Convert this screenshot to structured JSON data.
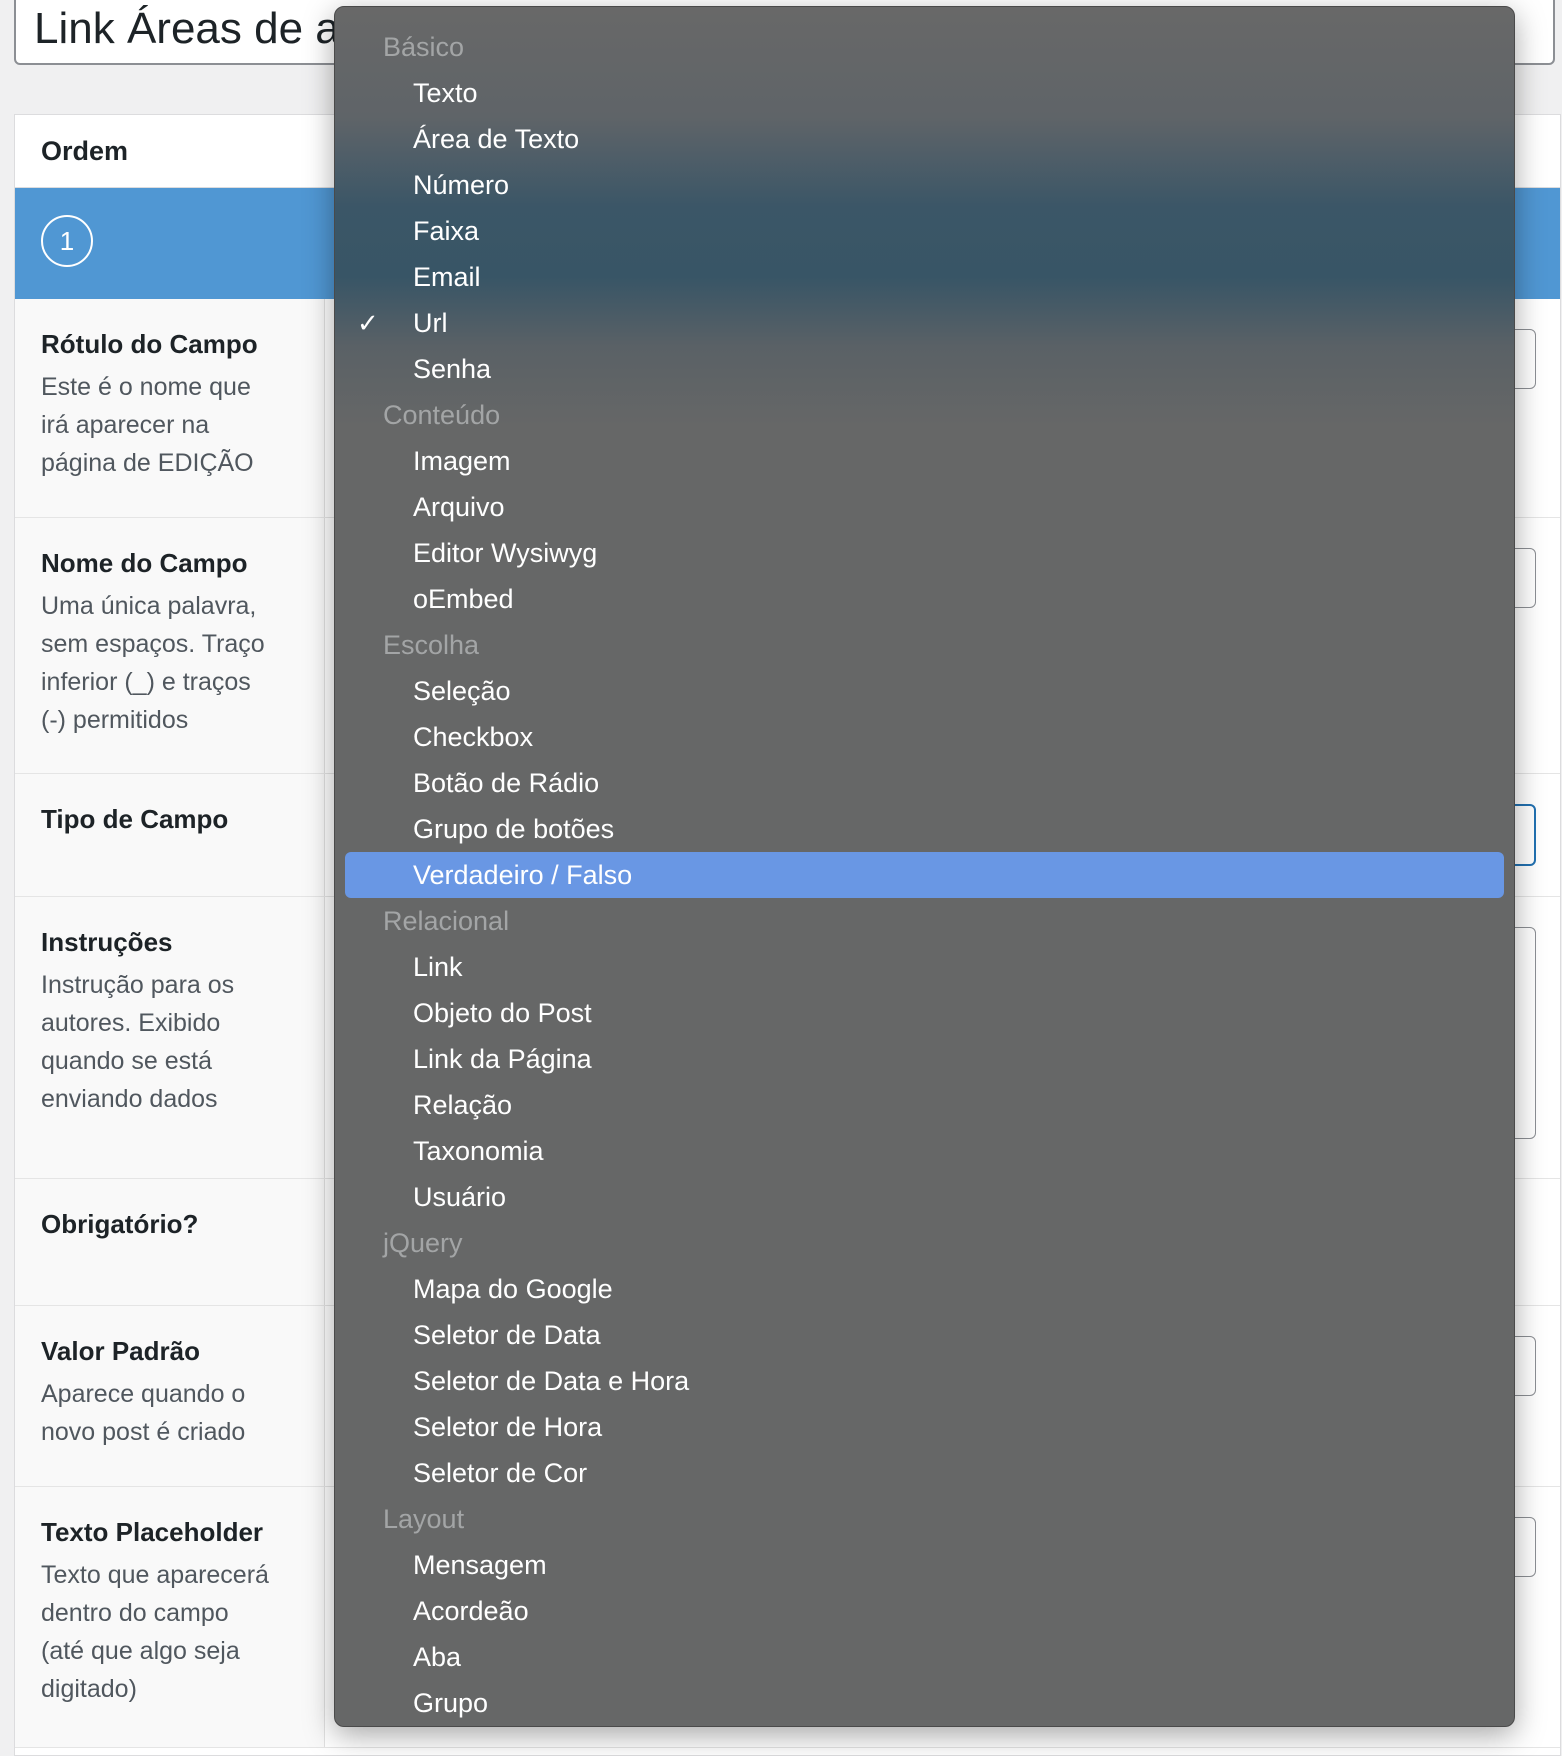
{
  "title_input": {
    "value": "Link Áreas de at"
  },
  "panel": {
    "header": "Ordem",
    "order_number": "1",
    "rows": [
      {
        "label": "Rótulo do Campo",
        "desc": [
          "Este é o nome que",
          "irá aparecer na",
          "página de EDIÇÃO"
        ],
        "h": 218,
        "field": "input"
      },
      {
        "label": "Nome do Campo",
        "desc": [
          "Uma única palavra,",
          "sem espaços. Traço",
          "inferior (_) e traços",
          "(-) permitidos"
        ],
        "h": 255,
        "field": "input"
      },
      {
        "label": "Tipo de Campo",
        "desc": [],
        "h": 122,
        "field": "select"
      },
      {
        "label": "Instruções",
        "desc": [
          "Instrução para os",
          "autores. Exibido",
          "quando se está",
          "enviando dados"
        ],
        "h": 281,
        "field": "textarea"
      },
      {
        "label": "Obrigatório?",
        "desc": [],
        "h": 126,
        "field": "none"
      },
      {
        "label": "Valor Padrão",
        "desc": [
          "Aparece quando o",
          "novo post é criado"
        ],
        "h": 180,
        "field": "input"
      },
      {
        "label": "Texto Placeholder",
        "desc": [
          "Texto que aparecerá",
          "dentro do campo",
          "(até que algo seja",
          "digitado)"
        ],
        "h": 260,
        "field": "input"
      }
    ]
  },
  "dropdown": {
    "selected": "Url",
    "highlighted": "Verdadeiro / Falso",
    "options": [
      {
        "type": "group",
        "label": "Básico"
      },
      {
        "type": "item",
        "label": "Texto"
      },
      {
        "type": "item",
        "label": "Área de Texto"
      },
      {
        "type": "item",
        "label": "Número"
      },
      {
        "type": "item",
        "label": "Faixa"
      },
      {
        "type": "item",
        "label": "Email"
      },
      {
        "type": "item",
        "label": "Url",
        "checked": true
      },
      {
        "type": "item",
        "label": "Senha"
      },
      {
        "type": "group",
        "label": "Conteúdo"
      },
      {
        "type": "item",
        "label": "Imagem"
      },
      {
        "type": "item",
        "label": "Arquivo"
      },
      {
        "type": "item",
        "label": "Editor Wysiwyg"
      },
      {
        "type": "item",
        "label": "oEmbed"
      },
      {
        "type": "group",
        "label": "Escolha"
      },
      {
        "type": "item",
        "label": "Seleção"
      },
      {
        "type": "item",
        "label": "Checkbox"
      },
      {
        "type": "item",
        "label": "Botão de Rádio"
      },
      {
        "type": "item",
        "label": "Grupo de botões"
      },
      {
        "type": "item",
        "label": "Verdadeiro / Falso",
        "highlighted": true
      },
      {
        "type": "group",
        "label": "Relacional"
      },
      {
        "type": "item",
        "label": "Link"
      },
      {
        "type": "item",
        "label": "Objeto do Post"
      },
      {
        "type": "item",
        "label": "Link da Página"
      },
      {
        "type": "item",
        "label": "Relação"
      },
      {
        "type": "item",
        "label": "Taxonomia"
      },
      {
        "type": "item",
        "label": "Usuário"
      },
      {
        "type": "group",
        "label": "jQuery"
      },
      {
        "type": "item",
        "label": "Mapa do Google"
      },
      {
        "type": "item",
        "label": "Seletor de Data"
      },
      {
        "type": "item",
        "label": "Seletor de Data e Hora"
      },
      {
        "type": "item",
        "label": "Seletor de Hora"
      },
      {
        "type": "item",
        "label": "Seletor de Cor"
      },
      {
        "type": "group",
        "label": "Layout"
      },
      {
        "type": "item",
        "label": "Mensagem"
      },
      {
        "type": "item",
        "label": "Acordeão"
      },
      {
        "type": "item",
        "label": "Aba"
      },
      {
        "type": "item",
        "label": "Grupo"
      }
    ]
  },
  "colors": {
    "accent": "#5097d3",
    "highlight": "#6997e4",
    "menu_bg": "#666767"
  }
}
